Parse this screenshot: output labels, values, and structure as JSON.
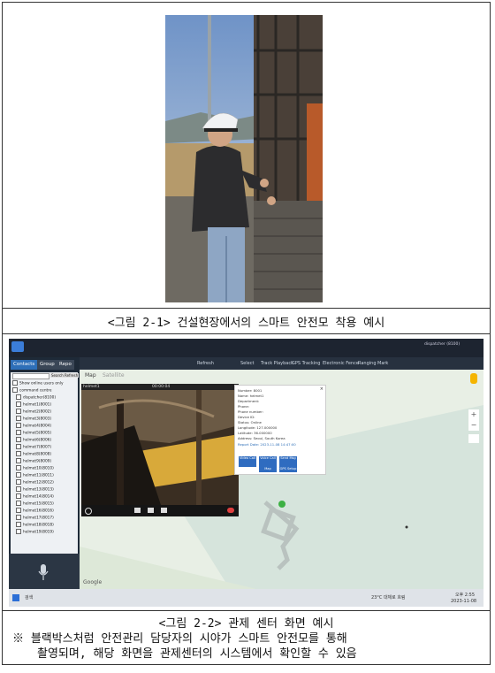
{
  "caption1": "<그림 2-1> 건설현장에서의 스마트 안전모 착용 예시",
  "caption2": "<그림 2-2> 관제 센터 화면 예시",
  "note_line1": "※ 블랙박스처럼 안전관리 담당자의 시야가 스마트 안전모를 통해",
  "note_line2": "촬영되며, 해당 화면을 관제센터의 시스템에서 확인할 수 있음",
  "screenshot": {
    "header_user": "dispatcher (8100)",
    "tabs": [
      "Contacts",
      "Group",
      "Repo"
    ],
    "toolbar_items": [
      "Refresh",
      "Select",
      "Track Playback",
      "GPS Tracking",
      "Electronic Fence",
      "Ranging",
      "Mark"
    ],
    "search_btn": "Search",
    "refresh_btn": "Refresh",
    "tree_items": [
      "Show online users only",
      "command centre",
      "dispatcher(8100)",
      "helmet1(8001)",
      "helmet2(8002)",
      "helmet3(8003)",
      "helmet4(8004)",
      "helmet5(8005)",
      "helmet6(8006)",
      "helmet7(8007)",
      "helmet8(8008)",
      "helmet9(8009)",
      "helmet10(8010)",
      "helmet11(8011)",
      "helmet12(8012)",
      "helmet13(8013)",
      "helmet14(8014)",
      "helmet15(8015)",
      "helmet16(8016)",
      "helmet17(8017)",
      "helmet18(8018)",
      "helmet19(8019)"
    ],
    "map_tabs": [
      "Map",
      "Satellite"
    ],
    "video_title": "helmet1",
    "video_time": "00:00:04",
    "popup_lines": [
      "Number: 8001",
      "Name: helmet1",
      "Department:",
      "Phone:",
      "Phone number:",
      "Device ID:",
      "Status: Online",
      "Longitude: 127.000000",
      "Latitude: 36.000000",
      "Address: Seoul, South Korea",
      "Report Date: 2023-11-08 14:47:00"
    ],
    "popup_buttons": [
      "Video Call",
      "Voice Call",
      "Send Msg",
      "Map",
      "GPS Setup"
    ],
    "google_label": "Google",
    "taskbar_search": "검색",
    "taskbar_time": "오후 2:55",
    "taskbar_date": "2023-11-08",
    "taskbar_weather": "23°C 대체로 흐림"
  },
  "colors": {
    "accent": "#2e6fb8",
    "dark": "#1d2430"
  }
}
